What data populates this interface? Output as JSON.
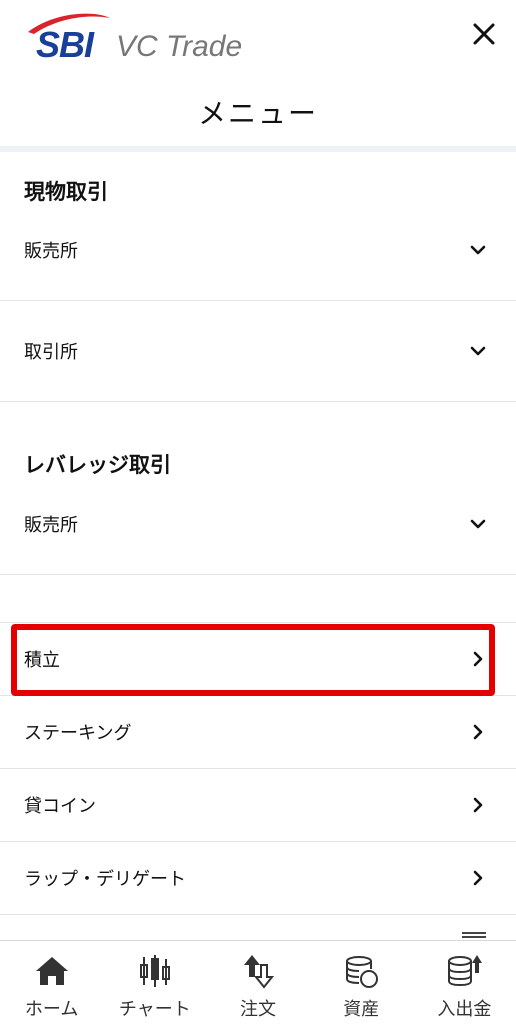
{
  "header": {
    "logo_sbi": "SBI",
    "logo_vc": "VC Trade",
    "title": "メニュー"
  },
  "sections": {
    "spot": {
      "title": "現物取引",
      "items": [
        {
          "label": "販売所",
          "icon": "chevron-down-icon"
        },
        {
          "label": "取引所",
          "icon": "chevron-down-icon"
        }
      ]
    },
    "leverage": {
      "title": "レバレッジ取引",
      "items": [
        {
          "label": "販売所",
          "icon": "chevron-down-icon"
        }
      ]
    }
  },
  "links": [
    {
      "label": "積立",
      "icon": "chevron-right-icon"
    },
    {
      "label": "ステーキング",
      "icon": "chevron-right-icon"
    },
    {
      "label": "貸コイン",
      "icon": "chevron-right-icon"
    },
    {
      "label": "ラップ・デリゲート",
      "icon": "chevron-right-icon"
    }
  ],
  "highlight_color": "#e40000",
  "bottom_nav": [
    {
      "label": "ホーム",
      "icon": "home-icon"
    },
    {
      "label": "チャート",
      "icon": "candlestick-chart-icon"
    },
    {
      "label": "注文",
      "icon": "order-arrows-icon"
    },
    {
      "label": "資産",
      "icon": "coins-icon"
    },
    {
      "label": "入出金",
      "icon": "deposit-withdraw-icon"
    }
  ]
}
